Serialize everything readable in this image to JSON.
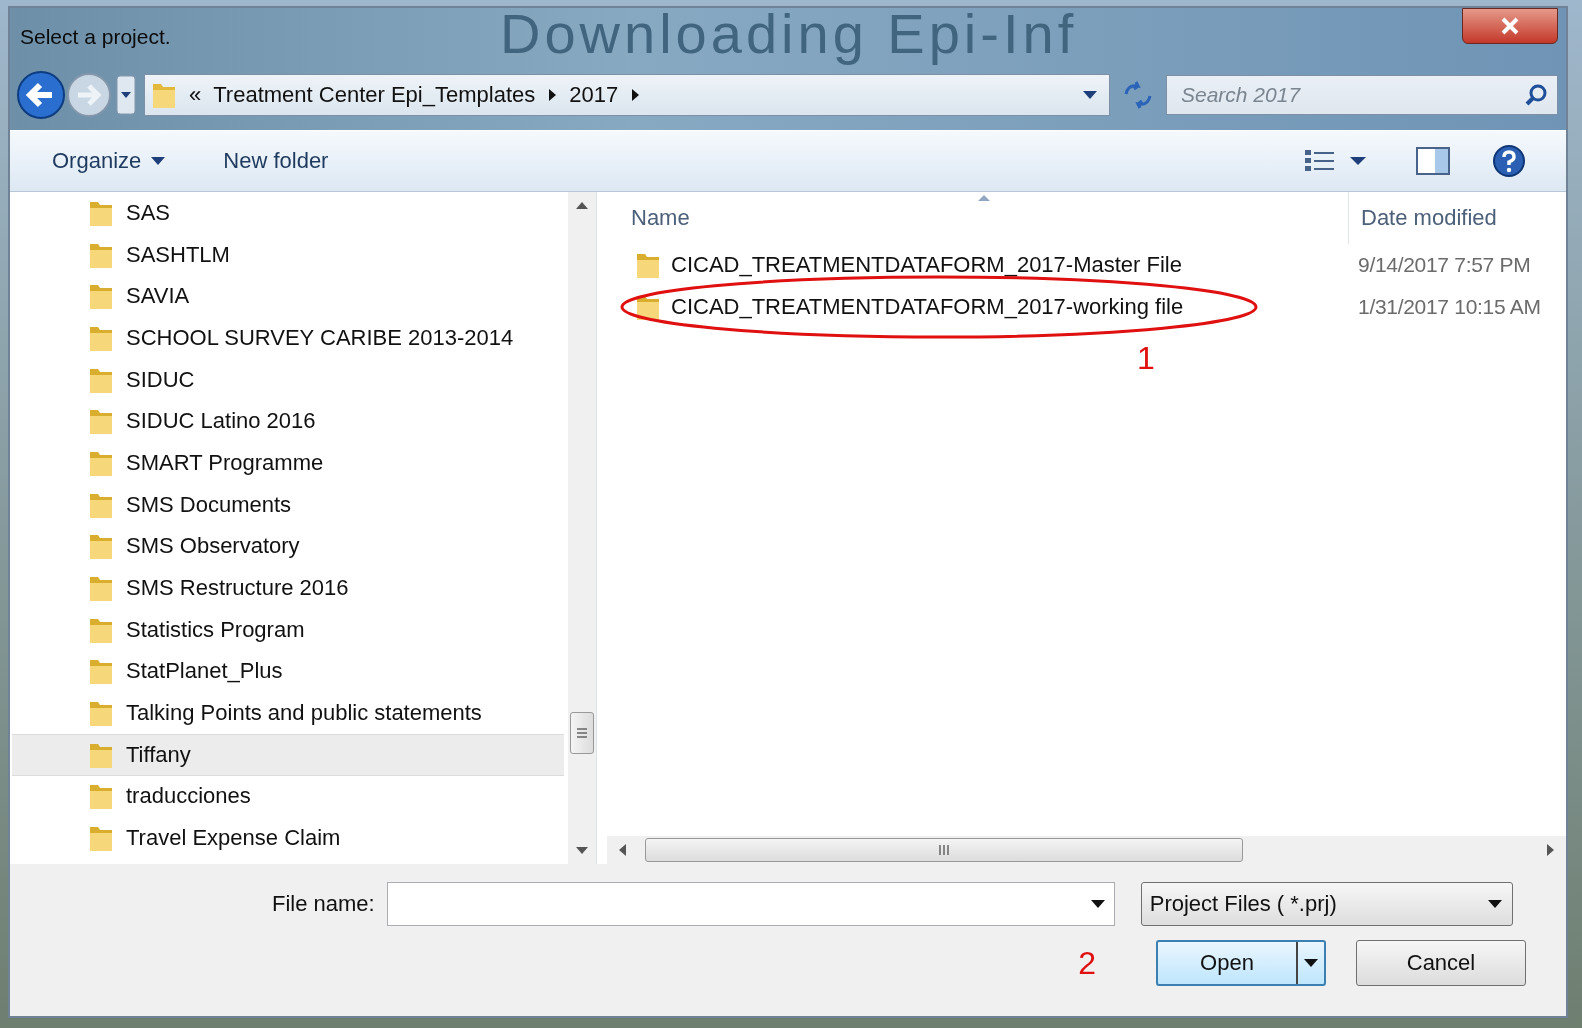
{
  "window": {
    "title": "Select a project.",
    "background_title": "Downloading Epi-Inf"
  },
  "address_bar": {
    "overflow_mark": "«",
    "crumbs": [
      "Treatment Center Epi_Templates",
      "2017"
    ]
  },
  "search": {
    "placeholder": "Search 2017"
  },
  "toolbar": {
    "buttons": [
      "Organize",
      "New folder"
    ]
  },
  "nav_pane": {
    "items": [
      {
        "label": "SAS",
        "selected": false
      },
      {
        "label": "SASHTLM",
        "selected": false
      },
      {
        "label": "SAVIA",
        "selected": false
      },
      {
        "label": "SCHOOL SURVEY CARIBE 2013-2014",
        "selected": false
      },
      {
        "label": "SIDUC",
        "selected": false
      },
      {
        "label": "SIDUC Latino 2016",
        "selected": false
      },
      {
        "label": "SMART Programme",
        "selected": false
      },
      {
        "label": "SMS Documents",
        "selected": false
      },
      {
        "label": "SMS Observatory",
        "selected": false
      },
      {
        "label": "SMS Restructure 2016",
        "selected": false
      },
      {
        "label": "Statistics Program",
        "selected": false
      },
      {
        "label": "StatPlanet_Plus",
        "selected": false
      },
      {
        "label": "Talking Points and public statements",
        "selected": false
      },
      {
        "label": "Tiffany",
        "selected": true
      },
      {
        "label": "traducciones",
        "selected": false
      },
      {
        "label": "Travel Expense Claim",
        "selected": false
      }
    ]
  },
  "file_list": {
    "columns": [
      "Name",
      "Date modified"
    ],
    "rows": [
      {
        "name": "CICAD_TREATMENTDATAFORM_2017-Master File",
        "date": "9/14/2017 7:57 PM",
        "circled": false
      },
      {
        "name": "CICAD_TREATMENTDATAFORM_2017-working file",
        "date": "1/31/2017 10:15 AM",
        "circled": true
      }
    ]
  },
  "file_name": {
    "label": "File name:"
  },
  "file_type": {
    "value": "Project Files ( *.prj)"
  },
  "buttons": {
    "open": "Open",
    "cancel": "Cancel"
  },
  "annotations": [
    "1",
    "2"
  ]
}
